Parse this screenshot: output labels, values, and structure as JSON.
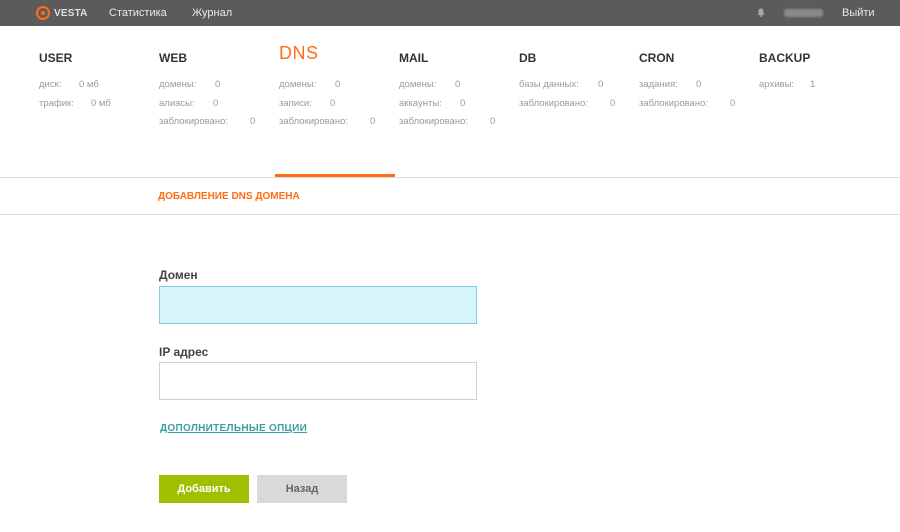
{
  "topbar": {
    "logo": "VESTA",
    "nav": [
      "Статистика",
      "Журнал"
    ],
    "logout": "Выйти",
    "icons": [
      "vesta-logo-icon",
      "bell-icon"
    ]
  },
  "stats": [
    {
      "title": "USER",
      "active": false,
      "rows": [
        {
          "label": "диск:",
          "value": "0 мб"
        },
        {
          "label": "трафик:",
          "value": "0 мб"
        }
      ]
    },
    {
      "title": "WEB",
      "active": false,
      "rows": [
        {
          "label": "домены:",
          "value": "0"
        },
        {
          "label": "алиасы:",
          "value": "0"
        },
        {
          "label": "заблокировано:",
          "value": "0"
        }
      ]
    },
    {
      "title": "DNS",
      "active": true,
      "rows": [
        {
          "label": "домены:",
          "value": "0"
        },
        {
          "label": "записи:",
          "value": "0"
        },
        {
          "label": "заблокировано:",
          "value": "0"
        }
      ]
    },
    {
      "title": "MAIL",
      "active": false,
      "rows": [
        {
          "label": "домены:",
          "value": "0"
        },
        {
          "label": "аккаунты:",
          "value": "0"
        },
        {
          "label": "заблокировано:",
          "value": "0"
        }
      ]
    },
    {
      "title": "DB",
      "active": false,
      "rows": [
        {
          "label": "базы данных:",
          "value": "0"
        },
        {
          "label": "заблокировано:",
          "value": "0"
        }
      ]
    },
    {
      "title": "CRON",
      "active": false,
      "rows": [
        {
          "label": "задания:",
          "value": "0"
        },
        {
          "label": "заблокировано:",
          "value": "0"
        }
      ]
    },
    {
      "title": "BACKUP",
      "active": false,
      "rows": [
        {
          "label": "архивы:",
          "value": "1"
        }
      ]
    }
  ],
  "form": {
    "section_title": "ДОБАВЛЕНИЕ DNS ДОМЕНА",
    "domain_label": "Домен",
    "domain_value": "",
    "ip_label": "IP адрес",
    "ip_value": "",
    "advanced_link": "ДОПОЛНИТЕЛЬНЫЕ ОПЦИИ",
    "add_button": "Добавить",
    "back_button": "Назад"
  },
  "colors": {
    "accent": "#ff6e14",
    "topbar": "#5b5b5b",
    "add_button": "#9fbf00",
    "back_button": "#d9d9d9",
    "link": "#3a9fa5",
    "focused_input": "#d6f5fb"
  }
}
